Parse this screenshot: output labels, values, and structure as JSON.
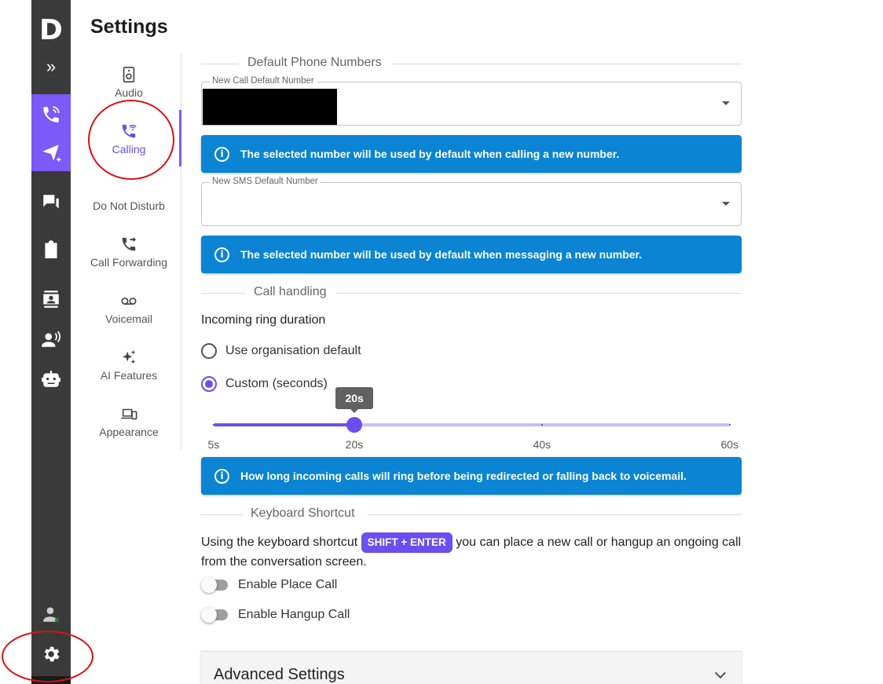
{
  "app": {
    "logo_letter": "D",
    "expand_glyph": "»"
  },
  "rail": {
    "icons": [
      "phone-plus-icon",
      "send-plus-icon",
      "chat-icon",
      "clipboard-icon",
      "contacts-icon",
      "voice-user-icon",
      "robot-icon",
      "user-status-icon",
      "gear-icon"
    ],
    "accent": "#7a5af8"
  },
  "settings": {
    "title": "Settings",
    "nav": [
      {
        "label": "Audio",
        "icon": "speaker-icon"
      },
      {
        "label": "Calling",
        "icon": "phone-wifi-icon",
        "active": true
      },
      {
        "label": "Do Not Disturb",
        "icon": "moon-icon"
      },
      {
        "label": "Call Forwarding",
        "icon": "phone-forward-icon"
      },
      {
        "label": "Voicemail",
        "icon": "voicemail-icon"
      },
      {
        "label": "AI Features",
        "icon": "sparkles-icon"
      },
      {
        "label": "Appearance",
        "icon": "devices-icon"
      }
    ]
  },
  "default_numbers": {
    "section_title": "Default Phone Numbers",
    "call_label": "New Call Default Number",
    "call_info": "The selected number will be used by default when calling a new number.",
    "sms_label": "New SMS Default Number",
    "sms_info": "The selected number will be used by default when messaging a new number."
  },
  "call_handling": {
    "section_title": "Call handling",
    "ring_duration_label": "Incoming ring duration",
    "option_default": "Use organisation default",
    "option_custom": "Custom (seconds)",
    "selected_option": "custom",
    "slider": {
      "min": 5,
      "max": 60,
      "value": 20,
      "value_label": "20s",
      "marks": [
        {
          "value": 5,
          "label": "5s"
        },
        {
          "value": 20,
          "label": "20s"
        },
        {
          "value": 40,
          "label": "40s"
        },
        {
          "value": 60,
          "label": "60s"
        }
      ]
    },
    "info": "How long incoming calls will ring before being redirected or falling back to voicemail."
  },
  "keyboard_shortcut": {
    "section_title": "Keyboard Shortcut",
    "text_before": "Using the keyboard shortcut ",
    "shortcut": "SHIFT + ENTER",
    "text_after": " you can place a new call or hangup an ongoing call from the conversation screen.",
    "place_call_label": "Enable Place Call",
    "place_call_enabled": false,
    "hangup_label": "Enable Hangup Call",
    "hangup_enabled": false
  },
  "advanced": {
    "title": "Advanced Settings"
  },
  "colors": {
    "primary": "#6b4ef0",
    "info": "#0a84d3",
    "rail": "#3a3a3a",
    "annotation": "#dd1111"
  },
  "info_glyph": "i"
}
